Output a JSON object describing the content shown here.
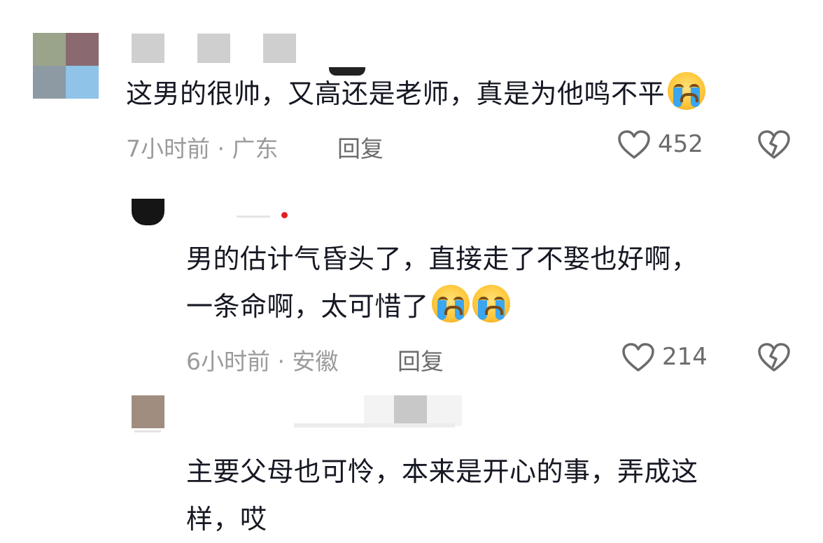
{
  "comments": [
    {
      "text": "这男的很帅，又高还是老师，真是为他鸣不平",
      "emoji": "loudly-crying-face",
      "time_location": "7小时前 · 广东",
      "reply_label": "回复",
      "likes": "452"
    },
    {
      "text_line1": "男的估计气昏头了，直接走了不娶也好啊，",
      "text_line2": "一条命啊，太可惜了",
      "emoji": "loudly-crying-face",
      "time_location": "6小时前 · 安徽",
      "reply_label": "回复",
      "likes": "214"
    },
    {
      "text_line1": "主要父母也可怜，本来是开心的事，弄成这",
      "text_line2": "样，哎"
    }
  ],
  "icons": {
    "like": "heart-outline-icon",
    "dislike": "broken-heart-icon",
    "emoji": "loudly-crying-face-emoji"
  },
  "colors": {
    "text": "#161823",
    "meta": "#9b9b9b",
    "action": "#6b6b6b",
    "red_dot": "#e02020"
  }
}
